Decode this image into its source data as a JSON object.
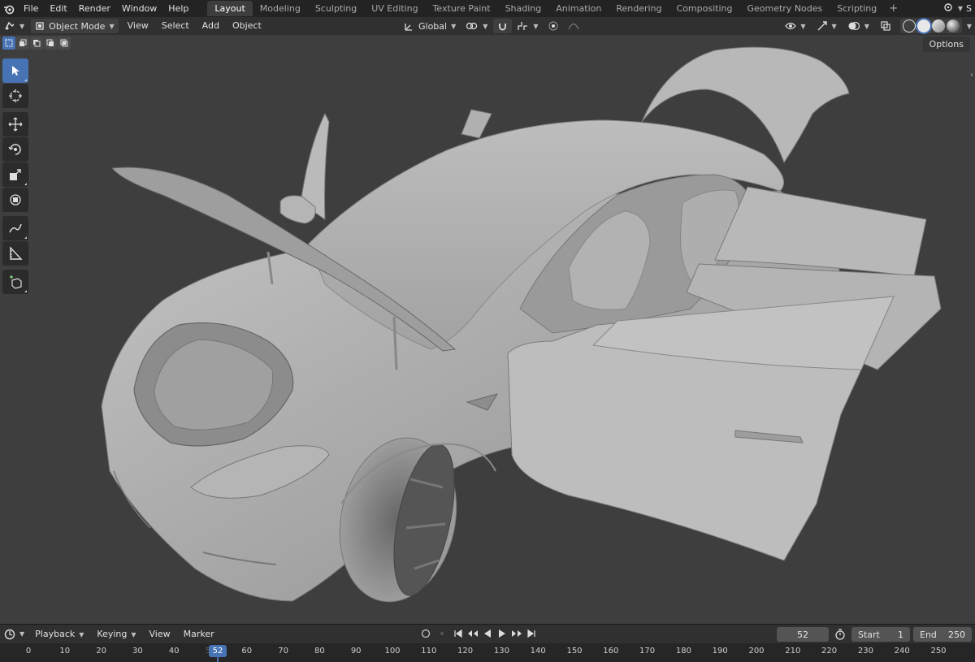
{
  "menubar": {
    "items": [
      "File",
      "Edit",
      "Render",
      "Window",
      "Help"
    ],
    "workspaces": [
      "Layout",
      "Modeling",
      "Sculpting",
      "UV Editing",
      "Texture Paint",
      "Shading",
      "Animation",
      "Rendering",
      "Compositing",
      "Geometry Nodes",
      "Scripting"
    ],
    "active_workspace": "Layout",
    "add_tab": "+",
    "scene_label": "S"
  },
  "viewport_header": {
    "mode": "Object Mode",
    "menus": [
      "View",
      "Select",
      "Add",
      "Object"
    ],
    "transform_orientation": "Global",
    "options": "Options"
  },
  "timeline": {
    "menus": [
      "Playback",
      "Keying",
      "View",
      "Marker"
    ],
    "current_frame": "52",
    "start_label": "Start",
    "start_value": "1",
    "end_label": "End",
    "end_value": "250",
    "ticks": [
      "0",
      "10",
      "20",
      "30",
      "40",
      "50",
      "60",
      "70",
      "80",
      "90",
      "100",
      "110",
      "120",
      "130",
      "140",
      "150",
      "160",
      "170",
      "180",
      "190",
      "200",
      "210",
      "220",
      "230",
      "240",
      "250"
    ]
  },
  "colors": {
    "accent": "#4772b3",
    "viewport_bg": "#3e3e3e",
    "header_bg": "#303030"
  }
}
